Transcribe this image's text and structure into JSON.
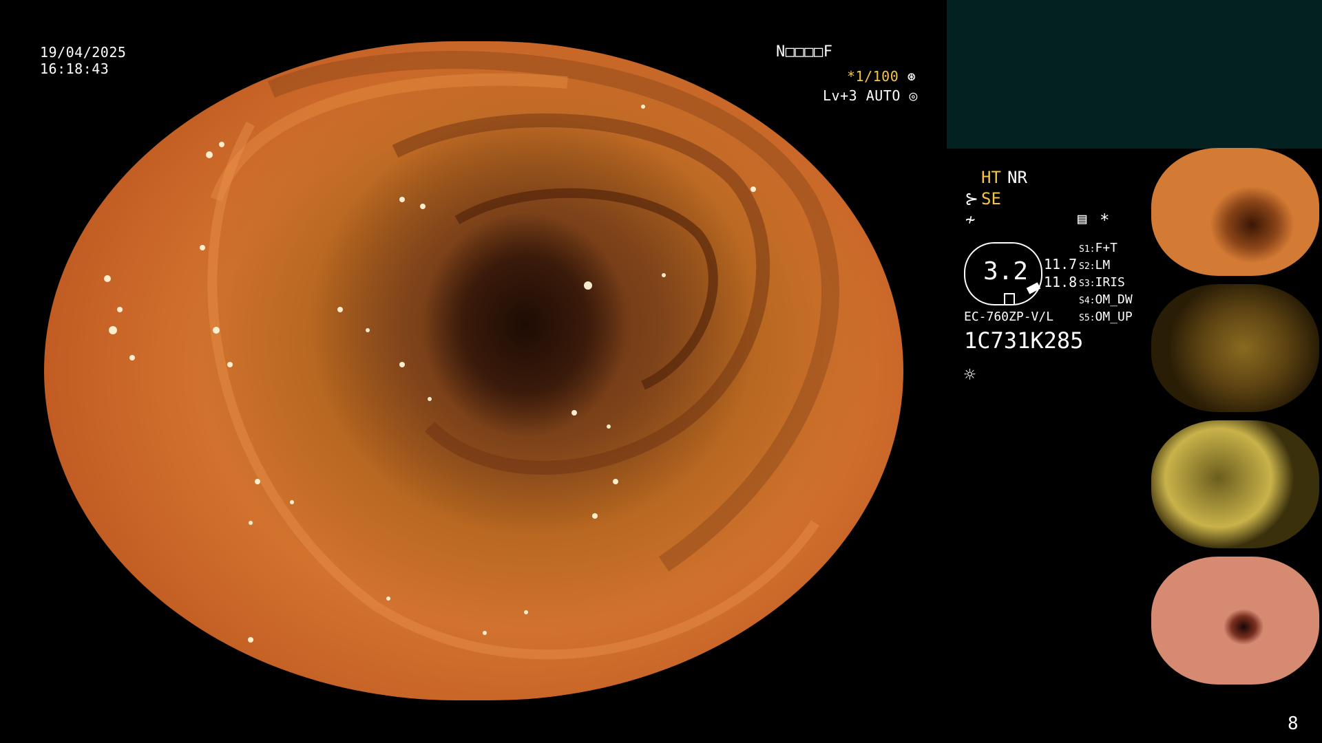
{
  "header": {
    "date": "19/04/2025",
    "time": "16:18:43"
  },
  "patient_id": "N□□□□F",
  "shutter": "*1/100",
  "shutter_icon": "aperture-icon",
  "level": "Lv+3 AUTO",
  "level_icon": "iris-icon",
  "settings": {
    "ht": "HT",
    "nr": "NR",
    "se": "SE",
    "scope_type": "EC-760ZP-V/L",
    "serial": "1C731K285",
    "zoom_value": "3.2",
    "val_a": "11.7",
    "val_b": "11.8",
    "asterisk": "*"
  },
  "switches": [
    {
      "id": "S1:",
      "label": "F+T"
    },
    {
      "id": "S2:",
      "label": "LM"
    },
    {
      "id": "S3:",
      "label": "IRIS"
    },
    {
      "id": "S4:",
      "label": "OM_DW"
    },
    {
      "id": "S5:",
      "label": "OM_UP"
    }
  ],
  "colors": {
    "accent_yellow": "#f6c542",
    "panel_teal": "#022120"
  },
  "icons": [
    "structure-enhance-icon",
    "filter-icon",
    "memory-icon",
    "light-icon"
  ],
  "thumbnails_count_label": "8"
}
